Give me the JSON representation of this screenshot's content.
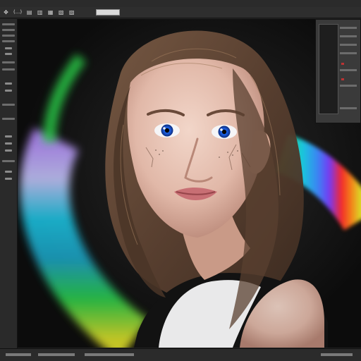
{
  "option_bar": {
    "icons": [
      "move-icon",
      "align-icon",
      "distribute-icon",
      "transform-icon",
      "grid-icon",
      "layers-icon"
    ],
    "label": "(...)",
    "field_value": ""
  },
  "canvas": {
    "content": "illustration"
  },
  "colors": {
    "ui_dark": "#222222",
    "panel": "#3a3a3a",
    "accent_red": "#bb3333",
    "rainbow": [
      "#7a3cff",
      "#3c8bff",
      "#19d3e6",
      "#2bd14a",
      "#e5e52a",
      "#ff8a1a",
      "#ff2a2a"
    ]
  }
}
